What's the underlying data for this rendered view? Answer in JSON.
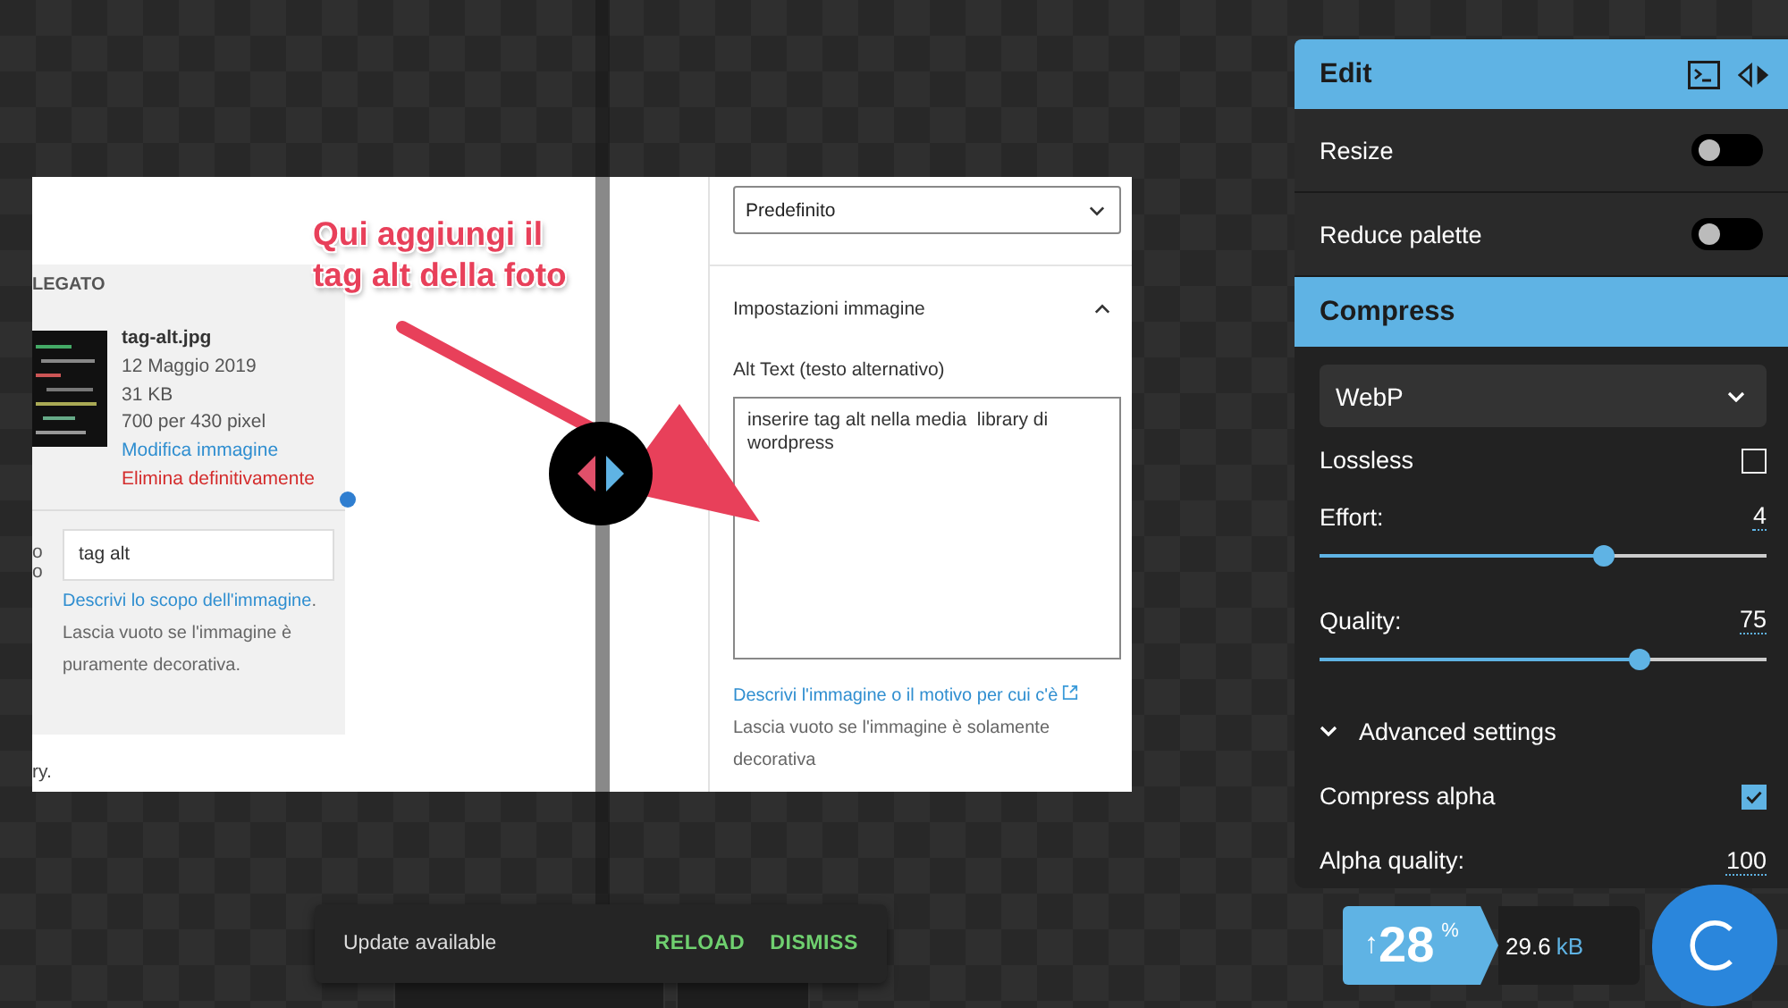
{
  "image": {
    "annotation_lines": [
      "Qui aggiungi il",
      "tag alt della foto"
    ],
    "section_heading": "LEGATO",
    "file": {
      "name": "tag-alt.jpg",
      "date": "12 Maggio 2019",
      "size": "31 KB",
      "dimensions": "700 per 430 pixel",
      "edit_link": "Modifica immagine",
      "delete_link": "Elimina definitivamente"
    },
    "cut_labels": [
      "o",
      "o"
    ],
    "alt_input": {
      "value": "tag alt"
    },
    "alt_help": {
      "link": "Descrivi lo scopo dell'immagine",
      "text": ". Lascia vuoto se l'immagine è puramente decorativa."
    },
    "footer_fragment": "ry.",
    "size_select": {
      "value": "Predefinito"
    },
    "settings_section": {
      "title": "Impostazioni immagine",
      "expanded": true
    },
    "alt_text_label": "Alt Text (testo alternativo)",
    "alt_textarea": {
      "value": "inserire tag alt nella media  library di wordpress"
    },
    "help": {
      "link": "Descrivi l'immagine o il motivo per cui c'è",
      "text": "Lascia vuoto se l'immagine è solamente decorativa"
    }
  },
  "panel": {
    "edit_title": "Edit",
    "toggles": [
      {
        "label": "Resize",
        "on": false
      },
      {
        "label": "Reduce palette",
        "on": false
      }
    ],
    "compress_title": "Compress",
    "codec": "WebP",
    "options": [
      {
        "kind": "checkbox",
        "label": "Lossless",
        "checked": false
      },
      {
        "kind": "slider",
        "label": "Effort:",
        "value": "4",
        "level": 0.66
      },
      {
        "kind": "slider",
        "label": "Quality:",
        "value": "75",
        "level": 0.74
      },
      {
        "kind": "expander",
        "label": "Advanced settings",
        "expanded": true
      },
      {
        "kind": "checkbox",
        "label": "Compress alpha",
        "checked": true
      },
      {
        "kind": "number",
        "label": "Alpha quality:",
        "value": "100"
      }
    ]
  },
  "result": {
    "arrow": "↑",
    "percent": "28",
    "percent_sign": "%",
    "size": "29.6",
    "unit": "kB"
  },
  "snackbar": {
    "message": "Update available",
    "actions": [
      "RELOAD",
      "DISMISS"
    ]
  }
}
